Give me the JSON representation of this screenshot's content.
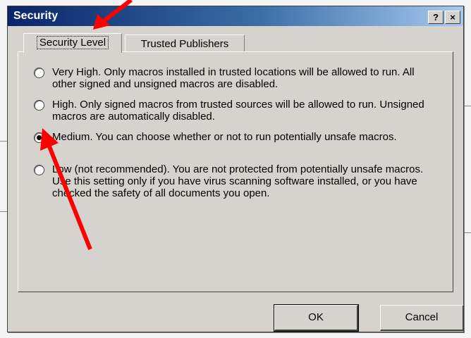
{
  "window": {
    "title": "Security",
    "help_label": "?",
    "close_label": "×"
  },
  "tabs": [
    {
      "label": "Security Level",
      "active": true
    },
    {
      "label": "Trusted Publishers",
      "active": false
    }
  ],
  "options": [
    {
      "text": "Very High. Only macros installed in trusted locations will be allowed to run. All other signed and unsigned macros are disabled.",
      "checked": false
    },
    {
      "text": "High. Only signed macros from trusted sources will be allowed to run. Unsigned macros are automatically disabled.",
      "checked": false
    },
    {
      "text": "Medium. You can choose whether or not to run potentially unsafe macros.",
      "checked": true
    },
    {
      "text": "Low (not recommended). You are not protected from potentially unsafe macros. Use this setting only if you have virus scanning software installed, or you have checked the safety of all documents you open.",
      "checked": false
    }
  ],
  "buttons": {
    "ok": "OK",
    "cancel": "Cancel"
  },
  "colors": {
    "title_gradient_start": "#0a246a",
    "title_gradient_end": "#a6caf0",
    "dialog_face": "#d6d3ce",
    "annotation_arrow": "#ff0000"
  }
}
